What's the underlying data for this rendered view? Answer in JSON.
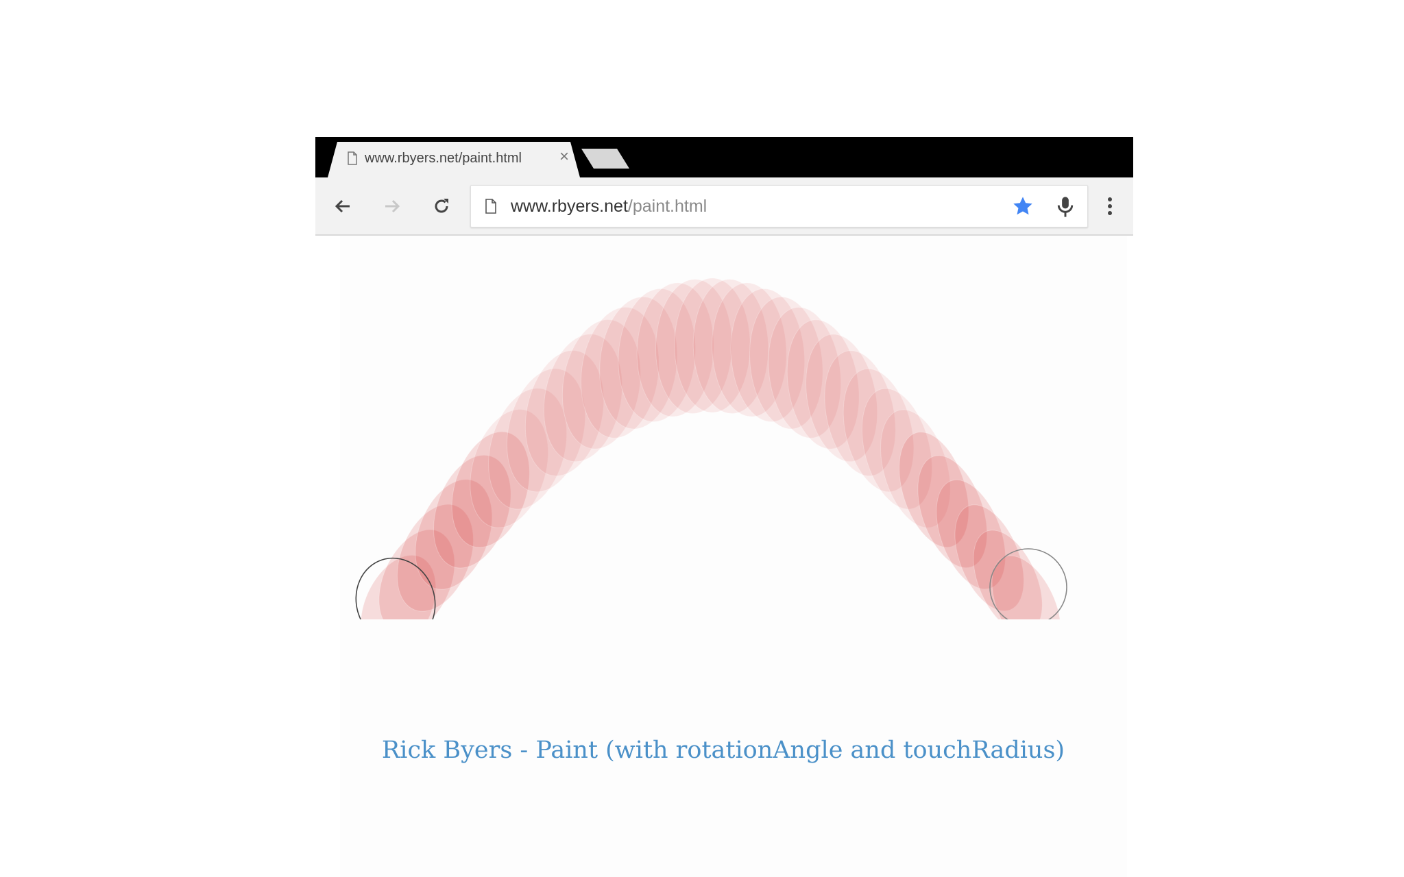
{
  "browser": {
    "tab": {
      "title": "www.rbyers.net/paint.html",
      "close_icon": "close-icon",
      "page_icon": "page-icon"
    },
    "new_tab_icon": "new-tab-icon",
    "toolbar": {
      "back_icon": "back-arrow-icon",
      "forward_icon": "forward-arrow-icon",
      "reload_icon": "reload-icon",
      "menu_icon": "more-vert-icon"
    },
    "omnibox": {
      "host": "www.rbyers.net",
      "path": "/paint.html",
      "bookmark_icon": "star-icon",
      "voice_icon": "mic-icon"
    }
  },
  "caption": "Rick Byers - Paint (with rotationAngle and touchRadius)",
  "colors": {
    "tabstrip": "#000000",
    "toolbar": "#f2f2f2",
    "paint": "#d32f2f",
    "star": "#4285f4",
    "caption": "#4a90c8"
  }
}
